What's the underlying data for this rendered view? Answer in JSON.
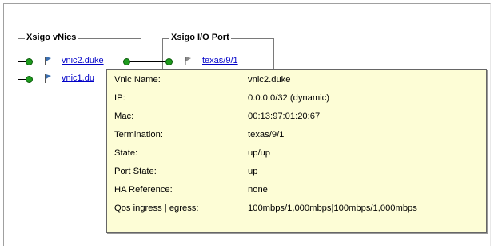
{
  "vnics_group": {
    "title": "Xsigo vNics",
    "items": [
      {
        "name": "vnic2.duke"
      },
      {
        "name": "vnic1.du"
      }
    ]
  },
  "io_ports_group": {
    "title": "Xsigo I/O Port",
    "items": [
      {
        "name": "texas/9/1"
      }
    ]
  },
  "tooltip": {
    "rows": [
      {
        "label": "Vnic Name:",
        "value": "vnic2.duke"
      },
      {
        "label": "IP:",
        "value": "0.0.0.0/32 (dynamic)"
      },
      {
        "label": "Mac:",
        "value": "00:13:97:01:20:67"
      },
      {
        "label": "Termination:",
        "value": "texas/9/1"
      },
      {
        "label": "State:",
        "value": "up/up"
      },
      {
        "label": "Port State:",
        "value": "up"
      },
      {
        "label": "HA Reference:",
        "value": "none"
      },
      {
        "label": "Qos ingress | egress:",
        "value": "100mbps/1,000mbps|100mbps/1,000mbps"
      }
    ]
  },
  "colors": {
    "node": "#1e9a1e",
    "link": "#0000c8",
    "tooltip_bg": "#fdfdd6",
    "vnic_flag": "#3a6fb0",
    "port_flag": "#8a8a8a"
  }
}
